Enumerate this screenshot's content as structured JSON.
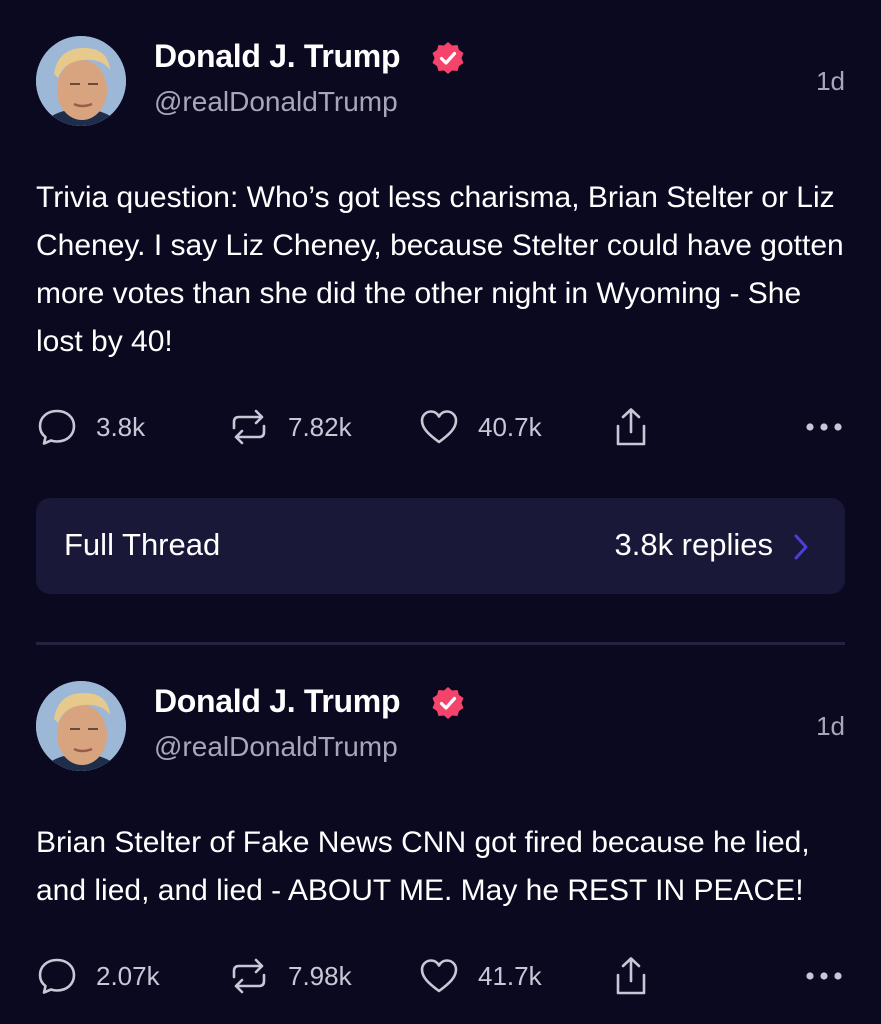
{
  "posts": [
    {
      "author": "Donald J. Trump",
      "handle": "@realDonaldTrump",
      "time": "1d",
      "text": "Trivia question: Who’s got less charisma, Brian Stelter or Liz Cheney. I say Liz Cheney, because Stelter could have gotten more votes than she did the other night in Wyoming - She lost by 40!",
      "replies": "3.8k",
      "reposts": "7.82k",
      "likes": "40.7k",
      "thread": {
        "label": "Full Thread",
        "count": "3.8k replies"
      }
    },
    {
      "author": "Donald J. Trump",
      "handle": "@realDonaldTrump",
      "time": "1d",
      "text": "Brian Stelter of Fake News CNN got fired because he lied, and lied, and lied - ABOUT ME. May he REST IN PEACE!",
      "replies": "2.07k",
      "reposts": "7.98k",
      "likes": "41.7k"
    }
  ],
  "icons": {
    "verified": "verified-badge-icon",
    "reply": "reply-bubble-icon",
    "repost": "repost-arrows-icon",
    "like": "heart-icon",
    "share": "share-upload-icon",
    "more": "more-dots-icon",
    "chevron": "chevron-right-icon"
  },
  "colors": {
    "background": "#0b0920",
    "verified": "#f4446b",
    "thread_bg": "#1a1838",
    "muted": "#a8a6b8",
    "chevron": "#4a3fd6"
  }
}
